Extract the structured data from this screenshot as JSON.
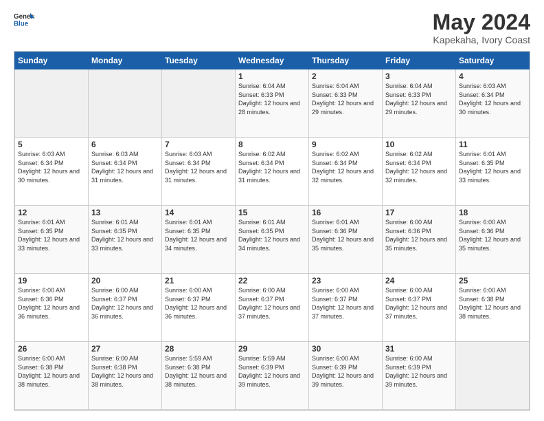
{
  "logo": {
    "line1": "General",
    "line2": "Blue"
  },
  "title": "May 2024",
  "subtitle": "Kapekaha, Ivory Coast",
  "days_header": [
    "Sunday",
    "Monday",
    "Tuesday",
    "Wednesday",
    "Thursday",
    "Friday",
    "Saturday"
  ],
  "weeks": [
    [
      {
        "day": "",
        "sunrise": "",
        "sunset": "",
        "daylight": ""
      },
      {
        "day": "",
        "sunrise": "",
        "sunset": "",
        "daylight": ""
      },
      {
        "day": "",
        "sunrise": "",
        "sunset": "",
        "daylight": ""
      },
      {
        "day": "1",
        "sunrise": "Sunrise: 6:04 AM",
        "sunset": "Sunset: 6:33 PM",
        "daylight": "Daylight: 12 hours and 28 minutes."
      },
      {
        "day": "2",
        "sunrise": "Sunrise: 6:04 AM",
        "sunset": "Sunset: 6:33 PM",
        "daylight": "Daylight: 12 hours and 29 minutes."
      },
      {
        "day": "3",
        "sunrise": "Sunrise: 6:04 AM",
        "sunset": "Sunset: 6:33 PM",
        "daylight": "Daylight: 12 hours and 29 minutes."
      },
      {
        "day": "4",
        "sunrise": "Sunrise: 6:03 AM",
        "sunset": "Sunset: 6:34 PM",
        "daylight": "Daylight: 12 hours and 30 minutes."
      }
    ],
    [
      {
        "day": "5",
        "sunrise": "Sunrise: 6:03 AM",
        "sunset": "Sunset: 6:34 PM",
        "daylight": "Daylight: 12 hours and 30 minutes."
      },
      {
        "day": "6",
        "sunrise": "Sunrise: 6:03 AM",
        "sunset": "Sunset: 6:34 PM",
        "daylight": "Daylight: 12 hours and 31 minutes."
      },
      {
        "day": "7",
        "sunrise": "Sunrise: 6:03 AM",
        "sunset": "Sunset: 6:34 PM",
        "daylight": "Daylight: 12 hours and 31 minutes."
      },
      {
        "day": "8",
        "sunrise": "Sunrise: 6:02 AM",
        "sunset": "Sunset: 6:34 PM",
        "daylight": "Daylight: 12 hours and 31 minutes."
      },
      {
        "day": "9",
        "sunrise": "Sunrise: 6:02 AM",
        "sunset": "Sunset: 6:34 PM",
        "daylight": "Daylight: 12 hours and 32 minutes."
      },
      {
        "day": "10",
        "sunrise": "Sunrise: 6:02 AM",
        "sunset": "Sunset: 6:34 PM",
        "daylight": "Daylight: 12 hours and 32 minutes."
      },
      {
        "day": "11",
        "sunrise": "Sunrise: 6:01 AM",
        "sunset": "Sunset: 6:35 PM",
        "daylight": "Daylight: 12 hours and 33 minutes."
      }
    ],
    [
      {
        "day": "12",
        "sunrise": "Sunrise: 6:01 AM",
        "sunset": "Sunset: 6:35 PM",
        "daylight": "Daylight: 12 hours and 33 minutes."
      },
      {
        "day": "13",
        "sunrise": "Sunrise: 6:01 AM",
        "sunset": "Sunset: 6:35 PM",
        "daylight": "Daylight: 12 hours and 33 minutes."
      },
      {
        "day": "14",
        "sunrise": "Sunrise: 6:01 AM",
        "sunset": "Sunset: 6:35 PM",
        "daylight": "Daylight: 12 hours and 34 minutes."
      },
      {
        "day": "15",
        "sunrise": "Sunrise: 6:01 AM",
        "sunset": "Sunset: 6:35 PM",
        "daylight": "Daylight: 12 hours and 34 minutes."
      },
      {
        "day": "16",
        "sunrise": "Sunrise: 6:01 AM",
        "sunset": "Sunset: 6:36 PM",
        "daylight": "Daylight: 12 hours and 35 minutes."
      },
      {
        "day": "17",
        "sunrise": "Sunrise: 6:00 AM",
        "sunset": "Sunset: 6:36 PM",
        "daylight": "Daylight: 12 hours and 35 minutes."
      },
      {
        "day": "18",
        "sunrise": "Sunrise: 6:00 AM",
        "sunset": "Sunset: 6:36 PM",
        "daylight": "Daylight: 12 hours and 35 minutes."
      }
    ],
    [
      {
        "day": "19",
        "sunrise": "Sunrise: 6:00 AM",
        "sunset": "Sunset: 6:36 PM",
        "daylight": "Daylight: 12 hours and 36 minutes."
      },
      {
        "day": "20",
        "sunrise": "Sunrise: 6:00 AM",
        "sunset": "Sunset: 6:37 PM",
        "daylight": "Daylight: 12 hours and 36 minutes."
      },
      {
        "day": "21",
        "sunrise": "Sunrise: 6:00 AM",
        "sunset": "Sunset: 6:37 PM",
        "daylight": "Daylight: 12 hours and 36 minutes."
      },
      {
        "day": "22",
        "sunrise": "Sunrise: 6:00 AM",
        "sunset": "Sunset: 6:37 PM",
        "daylight": "Daylight: 12 hours and 37 minutes."
      },
      {
        "day": "23",
        "sunrise": "Sunrise: 6:00 AM",
        "sunset": "Sunset: 6:37 PM",
        "daylight": "Daylight: 12 hours and 37 minutes."
      },
      {
        "day": "24",
        "sunrise": "Sunrise: 6:00 AM",
        "sunset": "Sunset: 6:37 PM",
        "daylight": "Daylight: 12 hours and 37 minutes."
      },
      {
        "day": "25",
        "sunrise": "Sunrise: 6:00 AM",
        "sunset": "Sunset: 6:38 PM",
        "daylight": "Daylight: 12 hours and 38 minutes."
      }
    ],
    [
      {
        "day": "26",
        "sunrise": "Sunrise: 6:00 AM",
        "sunset": "Sunset: 6:38 PM",
        "daylight": "Daylight: 12 hours and 38 minutes."
      },
      {
        "day": "27",
        "sunrise": "Sunrise: 6:00 AM",
        "sunset": "Sunset: 6:38 PM",
        "daylight": "Daylight: 12 hours and 38 minutes."
      },
      {
        "day": "28",
        "sunrise": "Sunrise: 5:59 AM",
        "sunset": "Sunset: 6:38 PM",
        "daylight": "Daylight: 12 hours and 38 minutes."
      },
      {
        "day": "29",
        "sunrise": "Sunrise: 5:59 AM",
        "sunset": "Sunset: 6:39 PM",
        "daylight": "Daylight: 12 hours and 39 minutes."
      },
      {
        "day": "30",
        "sunrise": "Sunrise: 6:00 AM",
        "sunset": "Sunset: 6:39 PM",
        "daylight": "Daylight: 12 hours and 39 minutes."
      },
      {
        "day": "31",
        "sunrise": "Sunrise: 6:00 AM",
        "sunset": "Sunset: 6:39 PM",
        "daylight": "Daylight: 12 hours and 39 minutes."
      },
      {
        "day": "",
        "sunrise": "",
        "sunset": "",
        "daylight": ""
      }
    ]
  ]
}
